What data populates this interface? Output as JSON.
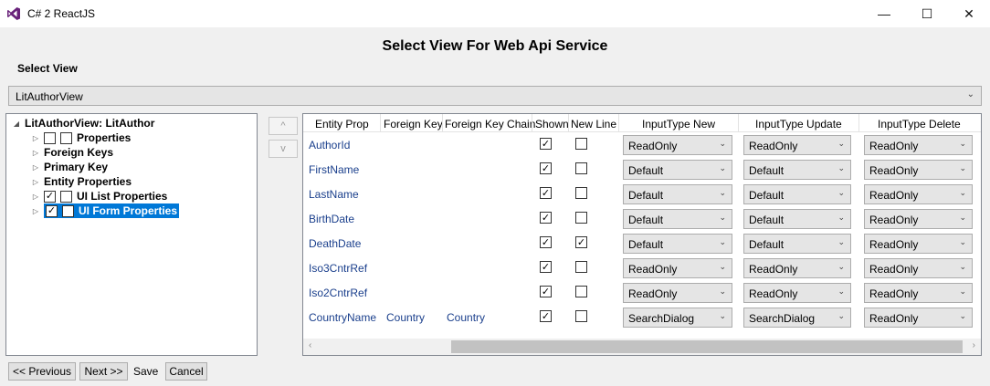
{
  "window": {
    "title": "C# 2 ReactJS",
    "minimize": "—",
    "maximize": "☐",
    "close": "✕"
  },
  "dialog": {
    "title": "Select View For Web Api Service",
    "select_view_label": "Select View"
  },
  "view_combo": {
    "value": "LitAuthorView",
    "arrow": "⌄"
  },
  "tree": {
    "root": "LitAuthorView: LitAuthor",
    "items": {
      "properties": {
        "label": "Properties",
        "checked": false
      },
      "foreign_keys": {
        "label": "Foreign Keys"
      },
      "primary_key": {
        "label": "Primary Key"
      },
      "entity_properties": {
        "label": "Entity Properties"
      },
      "ui_list": {
        "label": "UI List Properties",
        "checked": true
      },
      "ui_form": {
        "label": "UI Form Properties",
        "checked": true
      }
    }
  },
  "order_buttons": {
    "up": "^",
    "down": "v"
  },
  "grid": {
    "headers": [
      "Entity Prop",
      "Foreign Key",
      "Foreign Key Chain",
      "Shown",
      "New Line",
      "InputType New",
      "InputType Update",
      "InputType Delete"
    ],
    "rows": [
      {
        "prop": "AuthorId",
        "fk": "",
        "fkchain": "",
        "shown": true,
        "newline": false,
        "new": "ReadOnly",
        "update": "ReadOnly",
        "delete": "ReadOnly"
      },
      {
        "prop": "FirstName",
        "fk": "",
        "fkchain": "",
        "shown": true,
        "newline": false,
        "new": "Default",
        "update": "Default",
        "delete": "ReadOnly"
      },
      {
        "prop": "LastName",
        "fk": "",
        "fkchain": "",
        "shown": true,
        "newline": false,
        "new": "Default",
        "update": "Default",
        "delete": "ReadOnly"
      },
      {
        "prop": "BirthDate",
        "fk": "",
        "fkchain": "",
        "shown": true,
        "newline": false,
        "new": "Default",
        "update": "Default",
        "delete": "ReadOnly"
      },
      {
        "prop": "DeathDate",
        "fk": "",
        "fkchain": "",
        "shown": true,
        "newline": true,
        "new": "Default",
        "update": "Default",
        "delete": "ReadOnly"
      },
      {
        "prop": "Iso3CntrRef",
        "fk": "",
        "fkchain": "",
        "shown": true,
        "newline": false,
        "new": "ReadOnly",
        "update": "ReadOnly",
        "delete": "ReadOnly"
      },
      {
        "prop": "Iso2CntrRef",
        "fk": "",
        "fkchain": "",
        "shown": true,
        "newline": false,
        "new": "ReadOnly",
        "update": "ReadOnly",
        "delete": "ReadOnly"
      },
      {
        "prop": "CountryName",
        "fk": "Country",
        "fkchain": "Country",
        "shown": true,
        "newline": false,
        "new": "SearchDialog",
        "update": "SearchDialog",
        "delete": "ReadOnly"
      }
    ],
    "scroll_left": "‹",
    "scroll_right": "›"
  },
  "footer": {
    "previous": "<< Previous",
    "next": "Next >>",
    "save": "Save",
    "cancel": "Cancel"
  },
  "colors": {
    "selection": "#0078d7",
    "link_text": "#1a3f8c",
    "logo": "#68217a"
  },
  "icons": {
    "app": "visual-studio-logo"
  }
}
